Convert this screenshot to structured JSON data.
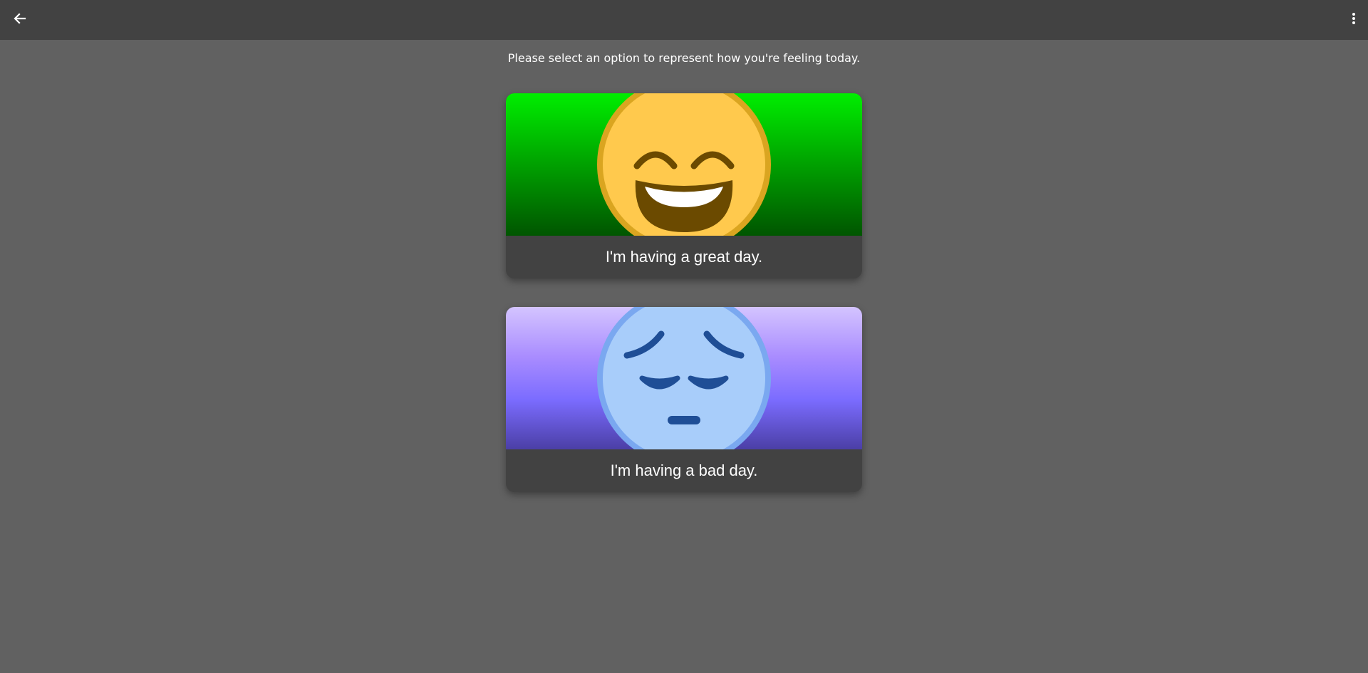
{
  "header": {
    "back_icon": "arrow-back-icon",
    "menu_icon": "more-vert-icon"
  },
  "prompt": "Please select an option to represent how you're feeling today.",
  "options": [
    {
      "label": "I'm having a great day.",
      "icon": "grinning-squinting-face-icon",
      "colors": {
        "top": "#00ee00",
        "bottom": "#005500",
        "face": "#ffc94d",
        "face_rim": "#daa520",
        "features": "#6b4a00"
      }
    },
    {
      "label": "I'm having a bad day.",
      "icon": "pensive-face-icon",
      "colors": {
        "top": "#d4c4ff",
        "bottom": "#4b3fa6",
        "face": "#a8cdfa",
        "face_rim": "#7aa8f0",
        "features": "#1f4e96"
      }
    }
  ]
}
